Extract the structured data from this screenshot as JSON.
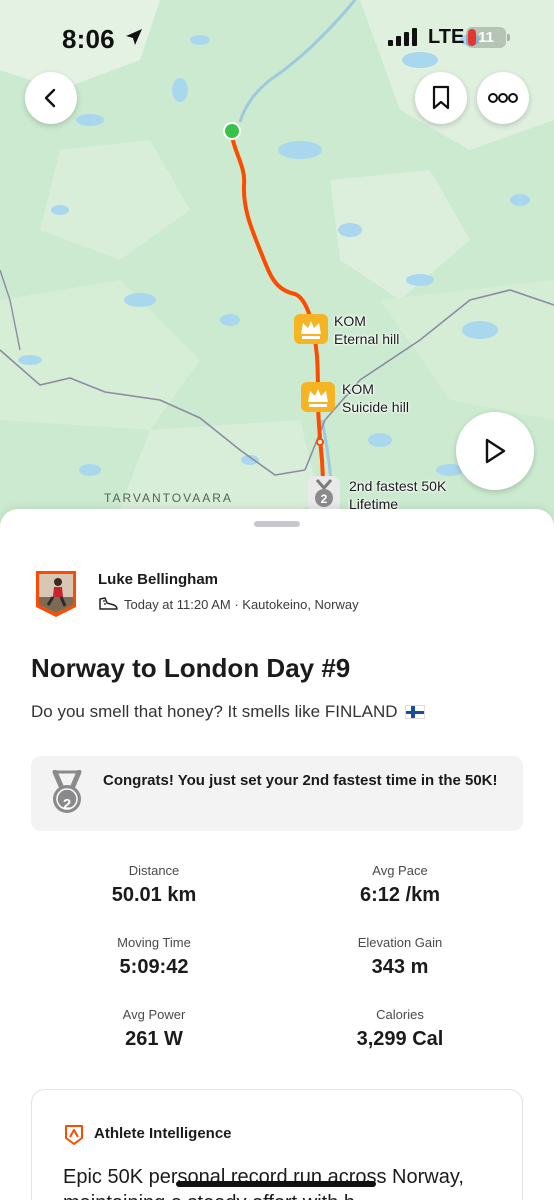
{
  "status_bar": {
    "time": "8:06",
    "network": "LTE",
    "battery": "11",
    "battery_level": 0.11
  },
  "map": {
    "segments": [
      {
        "badge": "KOM",
        "name": "Eternal hill"
      },
      {
        "badge": "KOM",
        "name": "Suicide hill"
      }
    ],
    "achievement": {
      "line1": "2nd fastest 50K",
      "line2": "Lifetime"
    },
    "place_label": "TARVANTOVAARA",
    "route_color": "#fc4c02",
    "start_color": "#38c24a"
  },
  "activity": {
    "athlete_name": "Luke Bellingham",
    "meta": "Today at 11:20 AM · Kautokeino, Norway",
    "title": "Norway to London Day #9",
    "description": "Do you smell that honey? It smells like FINLAND",
    "congrats": "Congrats! You just set your 2nd fastest time in the 50K!",
    "medal_rank": "2"
  },
  "stats": [
    {
      "label": "Distance",
      "value": "50.01 km"
    },
    {
      "label": "Avg Pace",
      "value": "6:12 /km"
    },
    {
      "label": "Moving Time",
      "value": "5:09:42"
    },
    {
      "label": "Elevation Gain",
      "value": "343 m"
    },
    {
      "label": "Avg Power",
      "value": "261 W"
    },
    {
      "label": "Calories",
      "value": "3,299 Cal"
    }
  ],
  "athlete_intelligence": {
    "title": "Athlete Intelligence",
    "body": "Epic 50K personal record run across Norway, maintaining a steady effort with h"
  },
  "icons": {
    "back": "chevron-left-icon",
    "save": "bookmark-icon",
    "more": "more-dots-icon",
    "play": "play-icon",
    "accent": "#fc4c02"
  }
}
